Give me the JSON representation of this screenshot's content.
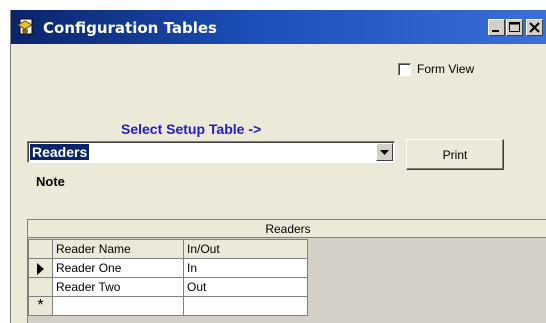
{
  "window": {
    "title": "Configuration Tables",
    "app_icon": "document-icon",
    "controls": [
      "minimize-icon",
      "maximize-icon",
      "close-icon"
    ]
  },
  "form_view": {
    "label": "Form View",
    "checked": false
  },
  "select_setup": {
    "label": "Select Setup Table ->",
    "selected_value": "Readers",
    "print_label": "Print"
  },
  "note": {
    "label": "Note"
  },
  "grid": {
    "caption": "Readers",
    "columns": [
      "Reader Name",
      "In/Out"
    ],
    "rows": [
      {
        "reader_name": "Reader One",
        "in_out": "In",
        "current": true
      },
      {
        "reader_name": "Reader Two",
        "in_out": "Out",
        "current": false
      }
    ],
    "new_row_marker": "*"
  },
  "colors": {
    "title_bar": "#0a246a",
    "select_label": "#1f1fbf",
    "selection": "#0a246a",
    "window_bg": "#ece9d8",
    "grid_bg": "#d4d0c8"
  }
}
